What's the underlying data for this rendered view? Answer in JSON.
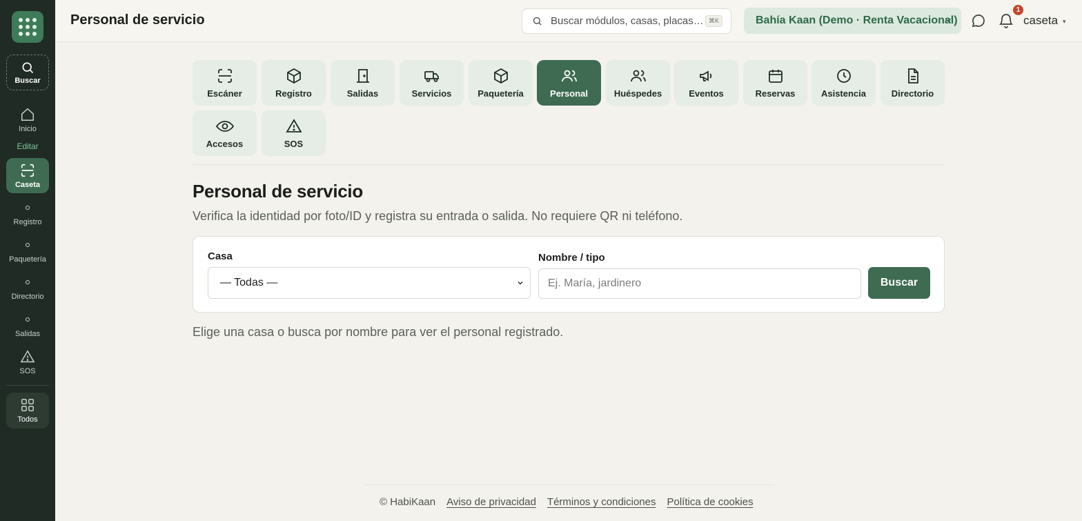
{
  "sidebar": {
    "search_label": "Buscar",
    "home_label": "Inicio",
    "section_label": "Editar",
    "caseta_label": "Caseta",
    "items": [
      {
        "label": "Registro"
      },
      {
        "label": "Paquetería"
      },
      {
        "label": "Directorio"
      },
      {
        "label": "Salidas"
      }
    ],
    "sos_label": "SOS",
    "all_label": "Todos"
  },
  "header": {
    "title": "Personal de servicio",
    "search_placeholder": "Buscar módulos, casas, placas…",
    "shortcut": "⌘K",
    "community": "Bahía Kaan (Demo · Renta Vacacional)",
    "notifications_count": "1",
    "user": "caseta"
  },
  "modules": [
    {
      "label": "Escáner",
      "icon": "scan-icon"
    },
    {
      "label": "Registro",
      "icon": "box-icon"
    },
    {
      "label": "Salidas",
      "icon": "door-icon"
    },
    {
      "label": "Servicios",
      "icon": "truck-icon"
    },
    {
      "label": "Paquetería",
      "icon": "package-icon"
    },
    {
      "label": "Personal",
      "icon": "users-icon",
      "active": true
    },
    {
      "label": "Huéspedes",
      "icon": "guests-icon"
    },
    {
      "label": "Eventos",
      "icon": "megaphone-icon"
    },
    {
      "label": "Reservas",
      "icon": "calendar-icon"
    },
    {
      "label": "Asistencia",
      "icon": "clock-icon"
    },
    {
      "label": "Directorio",
      "icon": "document-icon"
    },
    {
      "label": "Accesos",
      "icon": "eye-icon"
    },
    {
      "label": "SOS",
      "icon": "warning-icon"
    }
  ],
  "main": {
    "title": "Personal de servicio",
    "subtitle": "Verifica la identidad por foto/ID y registra su entrada o salida. No requiere QR ni teléfono.",
    "casa_label": "Casa",
    "casa_value": "— Todas —",
    "nombre_label": "Nombre / tipo",
    "nombre_placeholder": "Ej. María, jardinero",
    "search_button": "Buscar",
    "empty_hint": "Elige una casa o busca por nombre para ver el personal registrado."
  },
  "footer": {
    "copyright": "© HabiKaan",
    "links": [
      "Aviso de privacidad",
      "Términos y condiciones",
      "Política de cookies"
    ]
  },
  "colors": {
    "sidebar_bg": "#1f2b24",
    "accent": "#3e6b51",
    "tile_bg": "#e5ede6",
    "page_bg": "#f3f2ec",
    "badge": "#c6452e"
  }
}
